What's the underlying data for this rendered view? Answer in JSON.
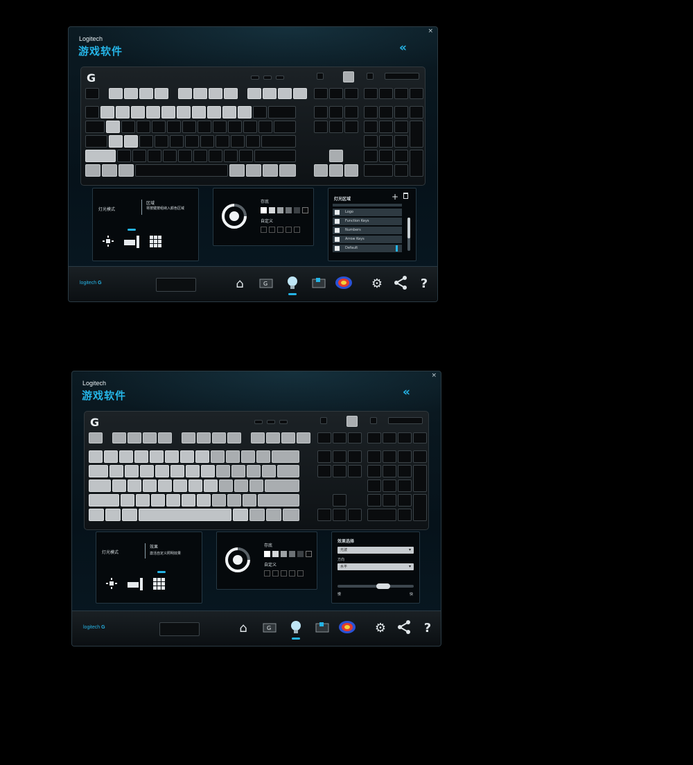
{
  "windows": [
    {
      "brand": "Logitech",
      "title": "游戏软件",
      "close": "×",
      "collapse": "«",
      "mode_panel": {
        "label": "灯光模式",
        "option_title": "区域",
        "option_desc": "将按键按组纳入颜色区域"
      },
      "color_panel": {
        "preset_label": "存底",
        "custom_label": "自定义"
      },
      "zone_panel": {
        "title": "灯光区域",
        "items": [
          "Logo",
          "Function Keys",
          "Numbers",
          "Arrow Keys",
          "Default"
        ]
      },
      "footer": {
        "logo_text": "logitech"
      }
    },
    {
      "brand": "Logitech",
      "title": "游戏软件",
      "close": "×",
      "collapse": "«",
      "mode_panel": {
        "label": "灯光模式",
        "option_title": "效果",
        "option_desc": "激活自定义照明效果"
      },
      "color_panel": {
        "preset_label": "存底",
        "custom_label": "自定义"
      },
      "effect_panel": {
        "title": "效果选择",
        "effect_value": "光波",
        "direction_label": "方向",
        "direction_value": "水平",
        "speed_slow": "慢",
        "speed_fast": "快",
        "speed_level": 0.6
      },
      "footer": {
        "logo_text": "logitech"
      }
    }
  ],
  "icons": {
    "nav": [
      "home-icon",
      "g-key-icon",
      "lighting-bulb-icon",
      "keyboard-key-icon",
      "heatmap-icon",
      "settings-gear-icon",
      "share-icon",
      "help-icon"
    ],
    "mode_icons": [
      "all-keys-light-icon",
      "zone-light-icon",
      "grid-light-icon"
    ]
  },
  "colors": {
    "accent": "#25b4e6",
    "key_lit": "#bfc3c6",
    "key_dark": "#0a0c0e"
  }
}
